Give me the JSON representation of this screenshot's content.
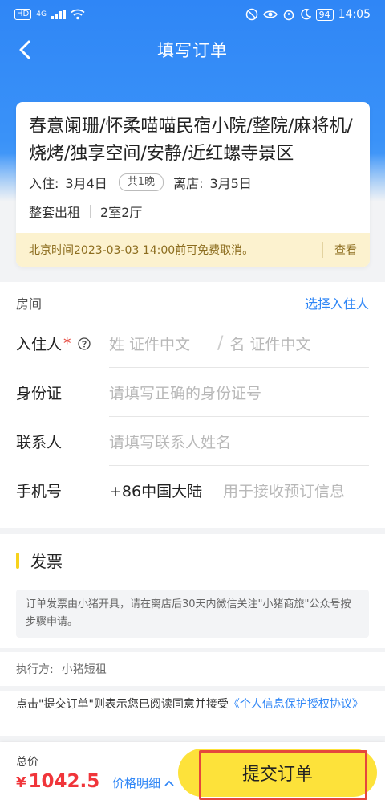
{
  "status_bar": {
    "left_badge": "HD",
    "network": "4G",
    "battery": "94",
    "time": "14:05"
  },
  "nav": {
    "title": "填写订单"
  },
  "hotel": {
    "name": "春意阑珊/怀柔喵喵民宿小院/整院/麻将机/烧烤/独享空间/安静/近红螺寺景区",
    "checkin_label": "入住:",
    "checkin_date": "3月4日",
    "nights": "共1晚",
    "checkout_label": "离店:",
    "checkout_date": "3月5日",
    "rent_type": "整套出租",
    "room_layout": "2室2厅",
    "cancel_policy": "北京时间2023-03-03 14:00前可免费取消。",
    "cancel_view": "查看"
  },
  "form": {
    "section_label": "房间",
    "select_guest": "选择入住人",
    "guest_label": "入住人",
    "required_mark": "*",
    "surname_placeholder": "姓 证件中文",
    "name_placeholder": "名 证件中文",
    "id_label": "身份证",
    "id_placeholder": "请填写正确的身份证号",
    "contact_label": "联系人",
    "contact_placeholder": "请填写联系人姓名",
    "phone_label": "手机号",
    "phone_country": "+86中国大陆",
    "phone_placeholder": "用于接收预订信息"
  },
  "invoice": {
    "title": "发票",
    "note": "订单发票由小猪开具，请在离店后30天内微信关注\"小猪商旅\"公众号按步骤申请。"
  },
  "executor": {
    "label": "执行方:",
    "value": "小猪短租"
  },
  "agreement": {
    "text": "点击\"提交订单\"则表示您已阅读同意并接受",
    "link": "《个人信息保护授权协议》"
  },
  "bottom": {
    "total_label": "总价",
    "currency": "¥",
    "total_price": "1042.5",
    "price_detail": "价格明细",
    "submit": "提交订单"
  },
  "colors": {
    "brand_blue": "#2f86f6",
    "submit_yellow": "#fde23a",
    "price_red": "#f0353a",
    "highlight_red": "#e5473c"
  }
}
